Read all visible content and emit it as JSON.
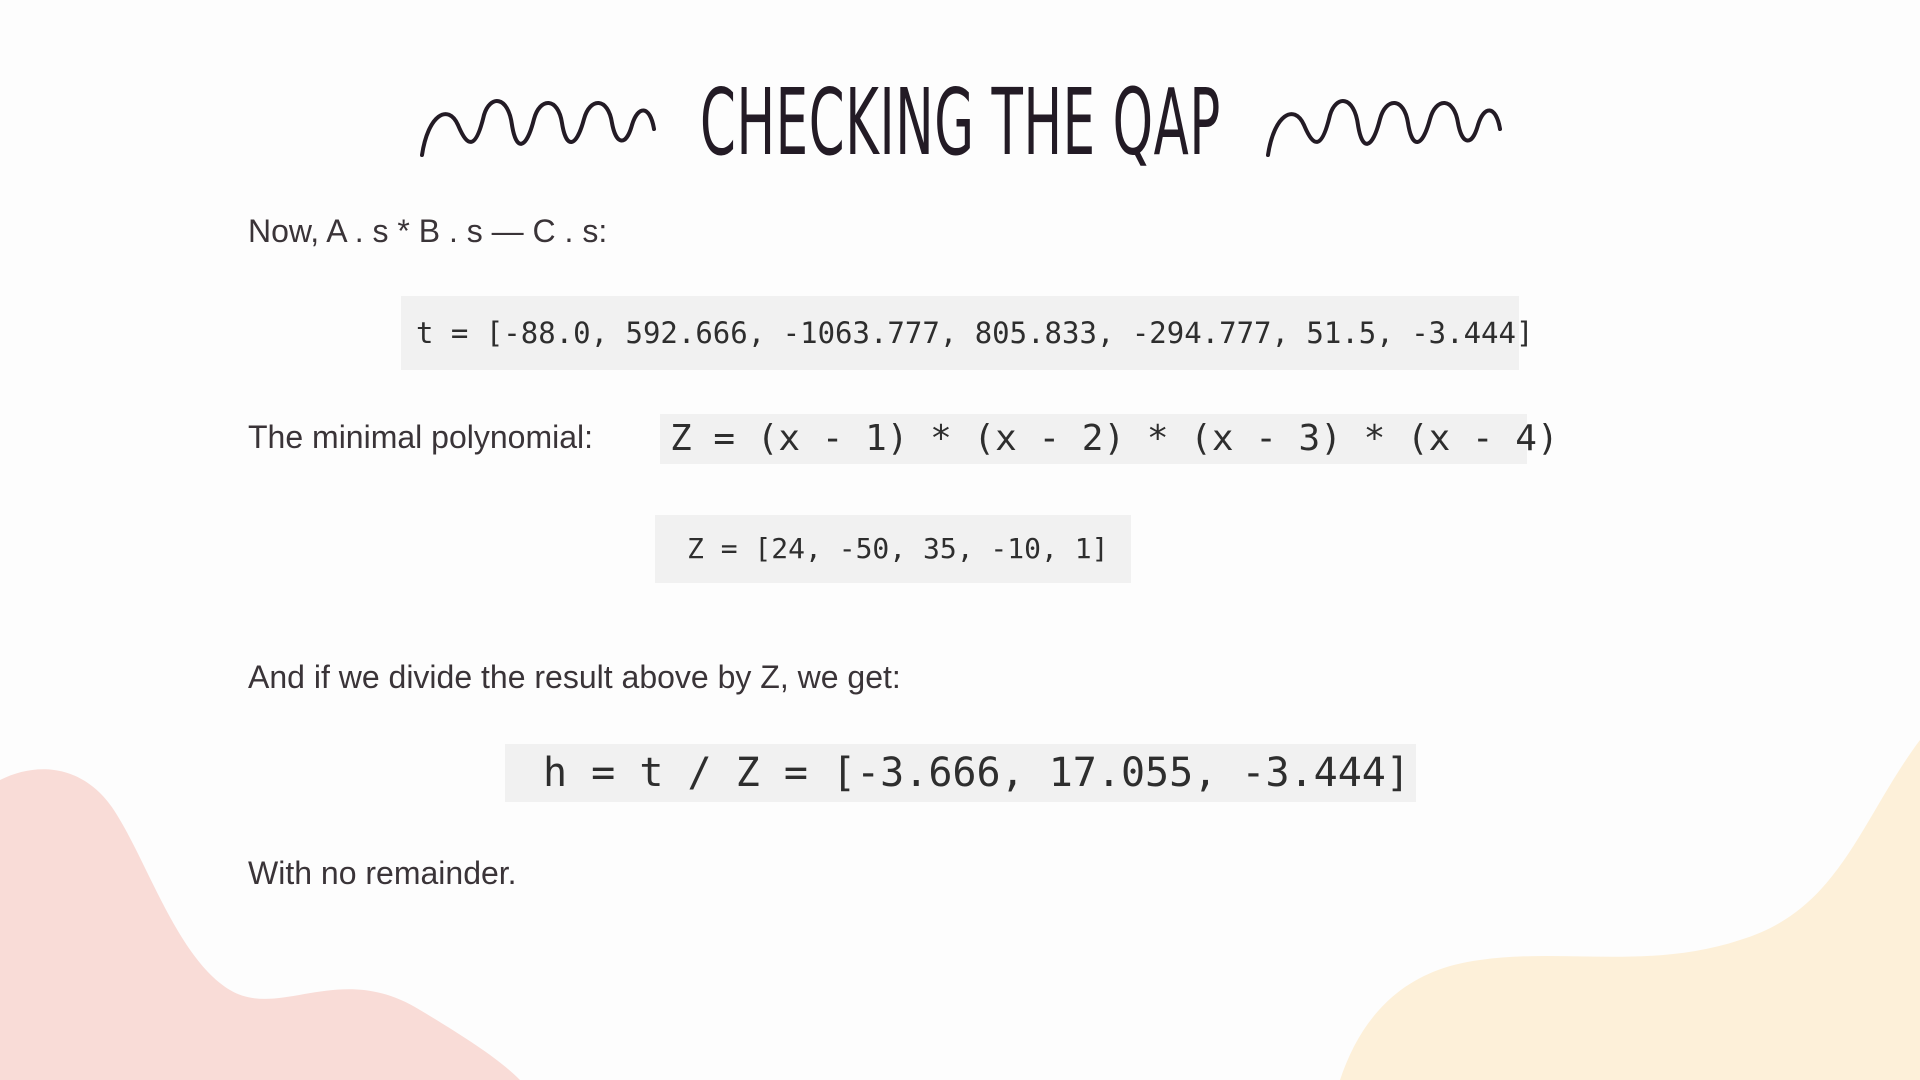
{
  "slide": {
    "title": "CHECKING THE QAP",
    "intro_text": "Now, A . s * B . s — C . s:",
    "t_code": "t = [-88.0, 592.666, -1063.777, 805.833, -294.777, 51.5, -3.444]",
    "minimal_poly_label": "The minimal polynomial:",
    "z_product_code": "Z = (x - 1) * (x - 2) * (x - 3) * (x - 4)",
    "z_coeffs_code": "Z = [24, -50, 35, -10, 1]",
    "divide_text": "And if we divide the result above by Z, we get:",
    "h_code": "h = t / Z = [-3.666, 17.055, -3.444]",
    "remainder_text": "With no remainder."
  },
  "colors": {
    "background": "#fdfdfd",
    "blob_left": "#f9dcd7",
    "blob_right": "#fdf0d9",
    "code_background": "#f1f1f1",
    "title_ink": "#231b25"
  },
  "decorations": {
    "left_ornament": "squiggle-icon",
    "right_ornament": "squiggle-icon"
  }
}
